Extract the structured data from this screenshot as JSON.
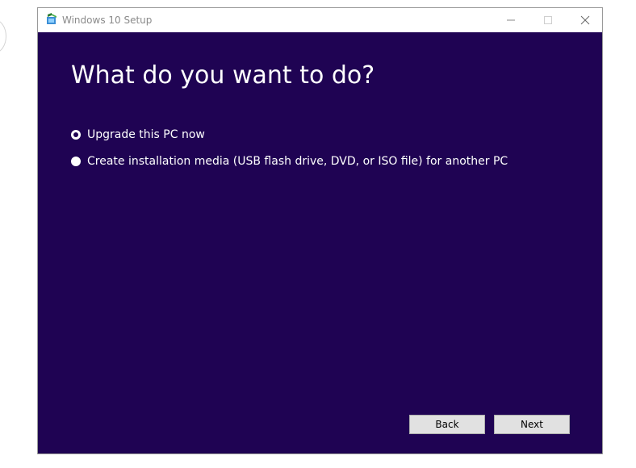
{
  "window": {
    "title": "Windows 10 Setup",
    "controls": {
      "minimize_icon": "minimize-icon",
      "maximize_icon": "maximize-icon",
      "close_icon": "close-icon"
    }
  },
  "page": {
    "heading": "What do you want to do?",
    "options": [
      {
        "label": "Upgrade this PC now",
        "selected": true
      },
      {
        "label": "Create installation media (USB flash drive, DVD, or ISO file) for another PC",
        "selected": false
      }
    ]
  },
  "footer": {
    "back_label": "Back",
    "next_label": "Next"
  },
  "colors": {
    "background": "#1f0353",
    "titlebar": "#ffffff",
    "button_face": "#e1e1e1"
  }
}
